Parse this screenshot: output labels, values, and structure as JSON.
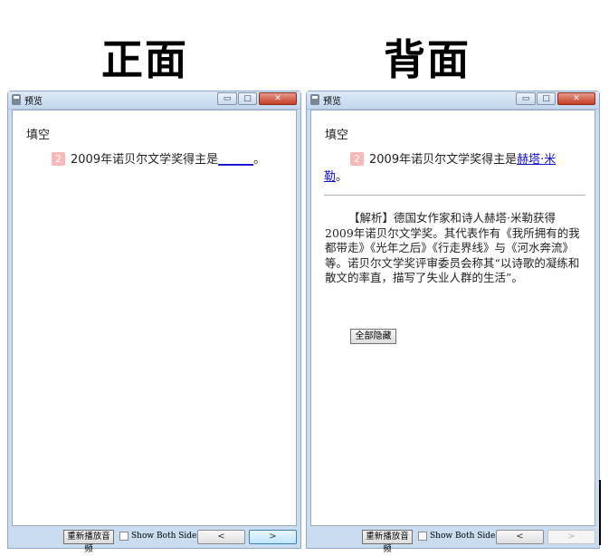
{
  "headings": {
    "front": "正面",
    "back": "背面"
  },
  "front_window": {
    "title": "预览",
    "question_type": "填空",
    "question_number": "2",
    "question_text": "2009年诺贝尔文学奖得主是",
    "blank": "______",
    "end_punct": "。",
    "replay_label": "重新播放音频",
    "show_both_label": "Show Both Sides",
    "prev_label": "<",
    "next_label": ">"
  },
  "back_window": {
    "title": "预览",
    "question_type": "填空",
    "question_number": "2",
    "question_text": "2009年诺贝尔文学奖得主是",
    "answer": "赫塔·米勒",
    "end_punct": "。",
    "analysis": "【解析】德国女作家和诗人赫塔·米勒获得2009年诺贝尔文学奖。其代表作有《我所拥有的我都带走》《光年之后》《行走界线》与《河水奔流》等。诺贝尔文学奖评审委员会称其“以诗歌的凝练和散文的率直，描写了失业人群的生活”。",
    "hide_all_label": "全部隐藏",
    "replay_label": "重新播放音频",
    "show_both_label": "Show Both Sides",
    "prev_label": "<",
    "next_label": ">"
  },
  "window_controls": {
    "minimize": "▭",
    "maximize": "□",
    "close": "✕"
  },
  "colors": {
    "blank_link": "#1111d6",
    "number_badge": "#f6b9b7",
    "frame": "#c9dcf0"
  }
}
